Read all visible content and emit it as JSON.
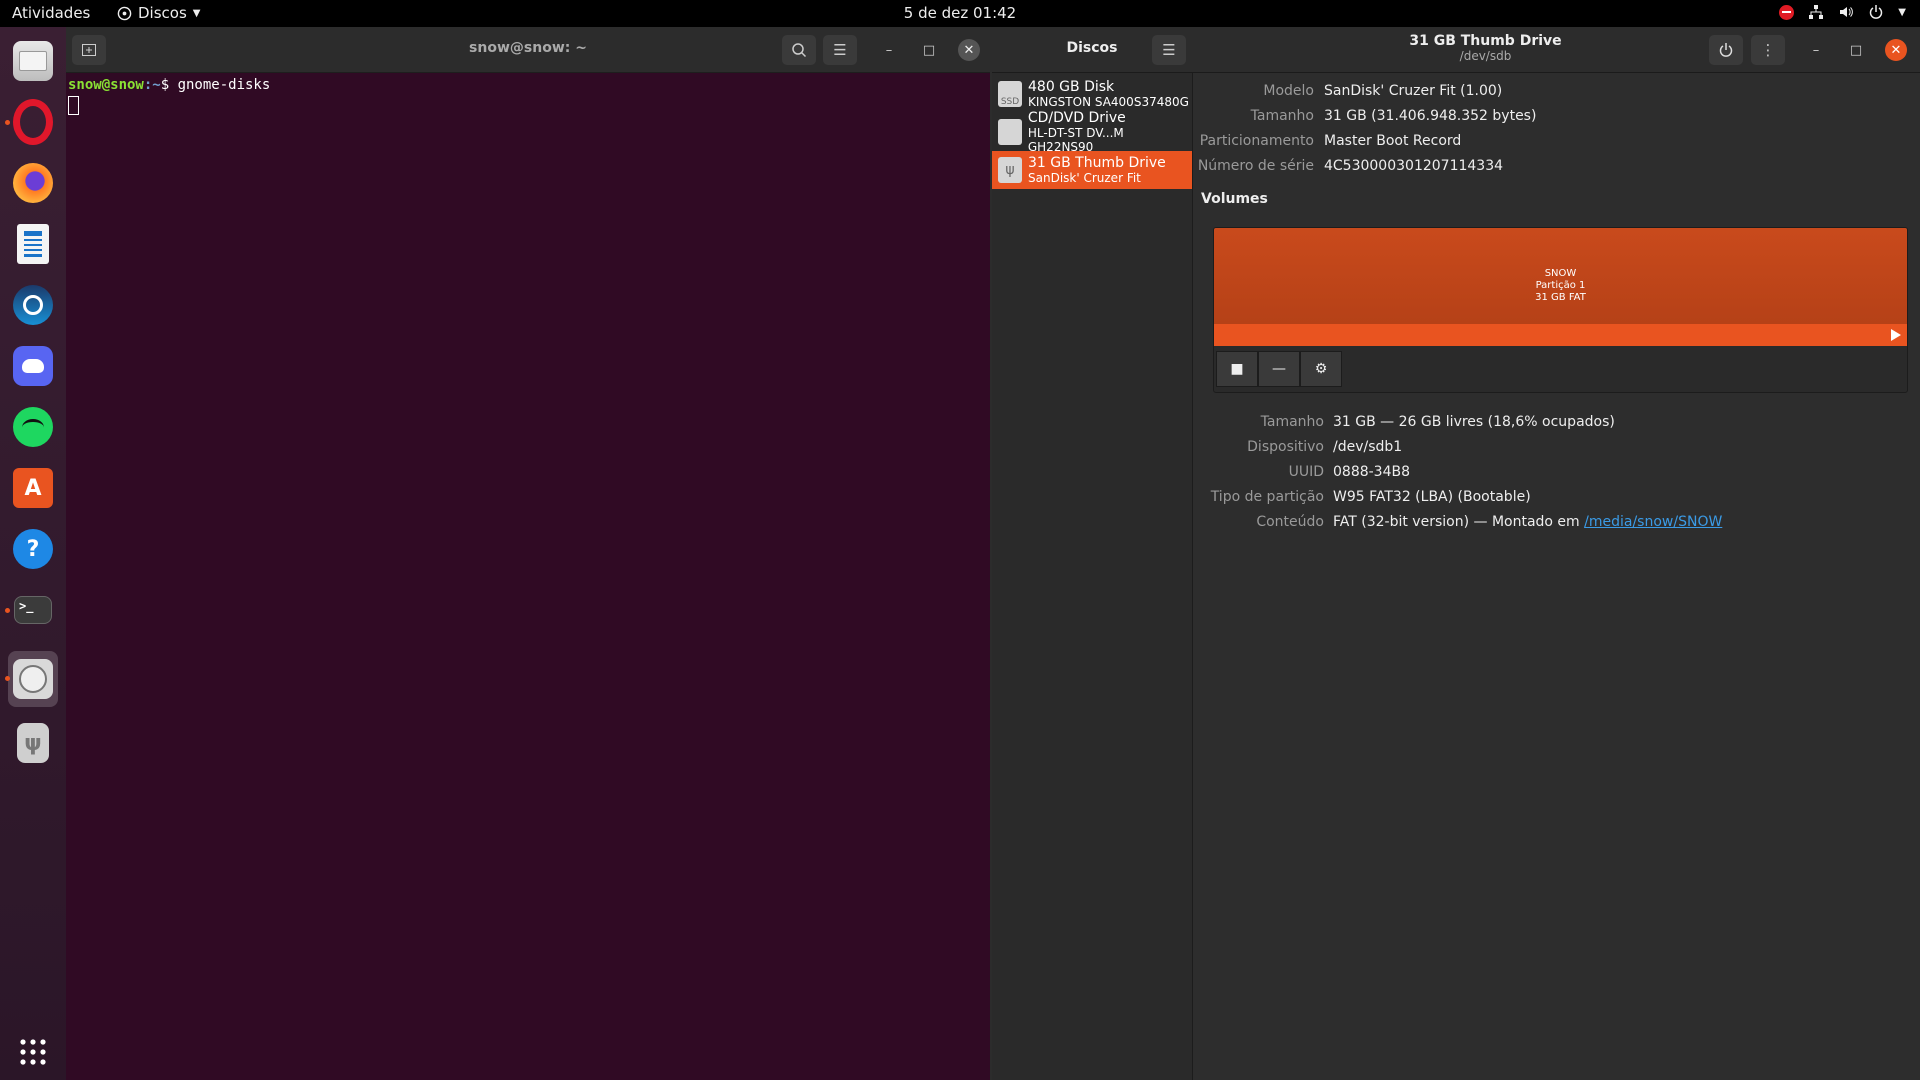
{
  "topbar": {
    "activities": "Atividades",
    "app_menu": "Discos",
    "clock": "5 de dez  01:42"
  },
  "terminal": {
    "title": "snow@snow: ~",
    "prompt_user": "snow@snow",
    "prompt_path": ":~",
    "prompt_symbol": "$ ",
    "command": "gnome-disks"
  },
  "disks": {
    "sidebar_title": "Discos",
    "items": [
      {
        "name": "480 GB Disk",
        "sub": "KINGSTON SA400S37480G",
        "icon_label": "SSD"
      },
      {
        "name": "CD/DVD Drive",
        "sub": "HL-DT-ST DV...M GH22NS90",
        "icon_label": ""
      },
      {
        "name": "31 GB Thumb Drive",
        "sub": "SanDisk' Cruzer Fit",
        "icon_label": "ψ"
      }
    ],
    "header_title": "31 GB Thumb Drive",
    "header_sub": "/dev/sdb",
    "info": {
      "model_label": "Modelo",
      "model": "SanDisk' Cruzer Fit (1.00)",
      "size_label": "Tamanho",
      "size": "31 GB (31.406.948.352 bytes)",
      "part_label": "Particionamento",
      "part": "Master Boot Record",
      "serial_label": "Número de série",
      "serial": "4C530000301207114334"
    },
    "volumes_title": "Volumes",
    "volume": {
      "name": "SNOW",
      "partition": "Partição 1",
      "desc": "31 GB FAT"
    },
    "details": {
      "size_label": "Tamanho",
      "size": "31 GB — 26 GB livres (18,6% ocupados)",
      "device_label": "Dispositivo",
      "device": "/dev/sdb1",
      "uuid_label": "UUID",
      "uuid": "0888-34B8",
      "ptype_label": "Tipo de partição",
      "ptype": "W95 FAT32 (LBA) (Bootable)",
      "content_label": "Conteúdo",
      "content_prefix": "FAT (32-bit version) — Montado em ",
      "content_link": "/media/snow/SNOW"
    }
  },
  "colors": {
    "accent": "#e95420",
    "terminal_bg": "#300a24",
    "link": "#3b9be6"
  }
}
